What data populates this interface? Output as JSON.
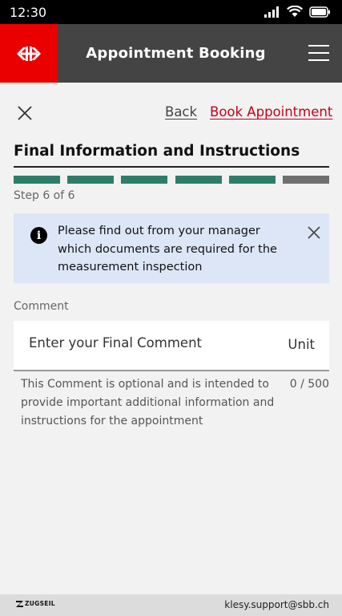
{
  "status_bar": {
    "time": "12:30",
    "icons": [
      "signal-icon",
      "wifi-icon",
      "battery-icon"
    ]
  },
  "header": {
    "title": "Appointment Booking",
    "logo": "sbb-logo-icon",
    "menu_icon": "hamburger-menu-icon",
    "colors": {
      "logo_bg": "#eb0000",
      "bar_bg": "#444444"
    }
  },
  "nav": {
    "close_icon": "close-icon",
    "back_label": "Back",
    "book_label": "Book Appointment",
    "book_color": "#c60018"
  },
  "section": {
    "title": "Final Information and Instructions",
    "step_label": "Step 6 of 6",
    "steps_total": 6,
    "steps_completed": 5,
    "colors": {
      "done": "#2e7d6b",
      "current": "#6f6f6f"
    }
  },
  "info_box": {
    "icon": "info-icon",
    "text": "Please find out from your manager which documents are required for the measurement inspection",
    "background": "#dde6f7"
  },
  "comment": {
    "label": "Comment",
    "placeholder": "Enter your Final Comment",
    "value": "",
    "unit": "Unit",
    "helper": "This Comment is optional and is intended to provide important additional information and instructions for the appointment",
    "count": "0 / 500"
  },
  "footer": {
    "brand": "ZUGSEIL",
    "email": "klesy.support@sbb.ch"
  }
}
